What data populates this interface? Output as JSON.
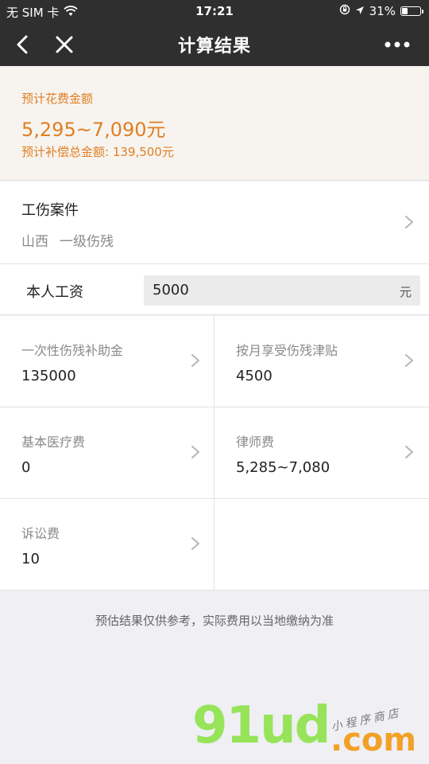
{
  "statusbar": {
    "carrier": "无 SIM 卡",
    "time": "17:21",
    "battery": "31%",
    "battery_level": 0.31
  },
  "navbar": {
    "title": "计算结果"
  },
  "summary": {
    "label": "预计花费金额",
    "range": "5,295~7,090元",
    "total": "预计补偿总金额: 139,500元"
  },
  "case": {
    "title": "工伤案件",
    "region": "山西",
    "level": "一级伤残"
  },
  "salary": {
    "label": "本人工资",
    "value": "5000",
    "unit": "元"
  },
  "items": [
    {
      "label": "一次性伤残补助金",
      "value": "135000"
    },
    {
      "label": "按月享受伤残津贴",
      "value": "4500"
    },
    {
      "label": "基本医疗费",
      "value": "0"
    },
    {
      "label": "律师费",
      "value": "5,285~7,080"
    },
    {
      "label": "诉讼费",
      "value": "10"
    }
  ],
  "footnote": "预估结果仅供参考，实际费用以当地缴纳为准",
  "watermark": {
    "main": "91ud",
    "domain": ".com",
    "tagline": "小程序商店"
  },
  "colors": {
    "accent": "#e07f22",
    "header_bg": "#2f2f2f",
    "page_bg": "#efeff4"
  }
}
